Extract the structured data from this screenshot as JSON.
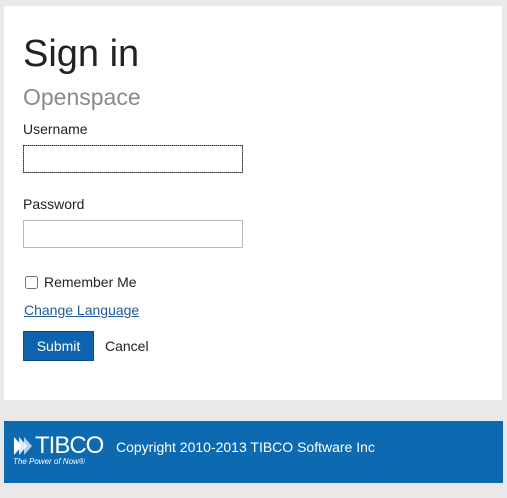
{
  "login": {
    "title": "Sign in",
    "subtitle": "Openspace",
    "username_label": "Username",
    "username_value": "",
    "password_label": "Password",
    "password_value": "",
    "remember_label": "Remember Me",
    "remember_checked": false,
    "change_language": "Change Language",
    "submit_label": "Submit",
    "cancel_label": "Cancel"
  },
  "footer": {
    "logo_text": "TIBCO",
    "logo_tagline": "The Power of Now®",
    "copyright": "Copyright 2010-2013 TIBCO Software Inc"
  },
  "colors": {
    "accent": "#0d63ad",
    "footer_bg": "#0d6ab0",
    "link": "#1f5d9c",
    "page_bg": "#e9e9e9"
  },
  "icons": [
    "tibco-logo-icon",
    "checkbox-icon"
  ]
}
